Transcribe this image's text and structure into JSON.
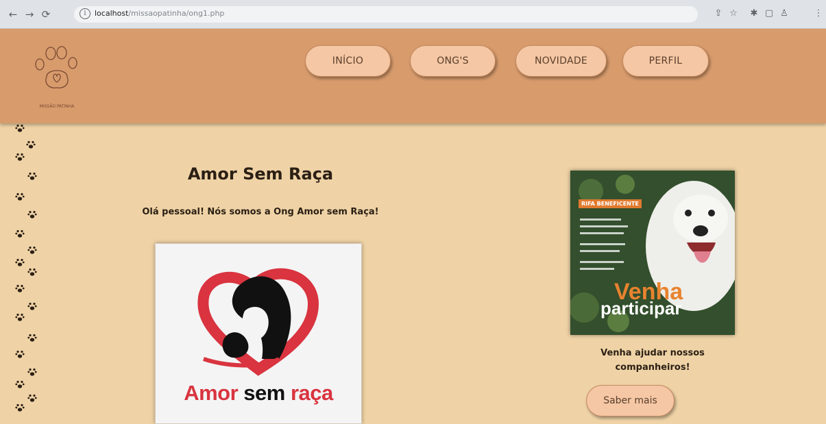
{
  "browser": {
    "back_icon": "arrow-left-icon",
    "forward_icon": "arrow-right-icon",
    "reload_icon": "reload-icon",
    "url_host": "localhost",
    "url_path": "/missaopatinha/ong1.php"
  },
  "header": {
    "logo_text": "MISSÃO PATINHA",
    "nav": [
      {
        "label": "INÍCIO"
      },
      {
        "label": "ONG'S"
      },
      {
        "label": "NOVIDADE"
      },
      {
        "label": "PERFIL"
      }
    ]
  },
  "org": {
    "title": "Amor Sem Raça",
    "greeting": "Olá pessoal! Nós somos a Ong Amor sem Raça!",
    "logo_word1": "Amor",
    "logo_word2": "sem",
    "logo_word3": "raça"
  },
  "raffle": {
    "tag": "RIFA BENEFICENTE",
    "big1": "Venha",
    "big2": "participar",
    "cta": "Venha ajudar nossos companheiros!",
    "button": "Saber mais"
  },
  "colors": {
    "background": "#efd3a6",
    "header": "#d89b6c",
    "button": "#f5c7a4",
    "logo_red": "#d9343f"
  }
}
